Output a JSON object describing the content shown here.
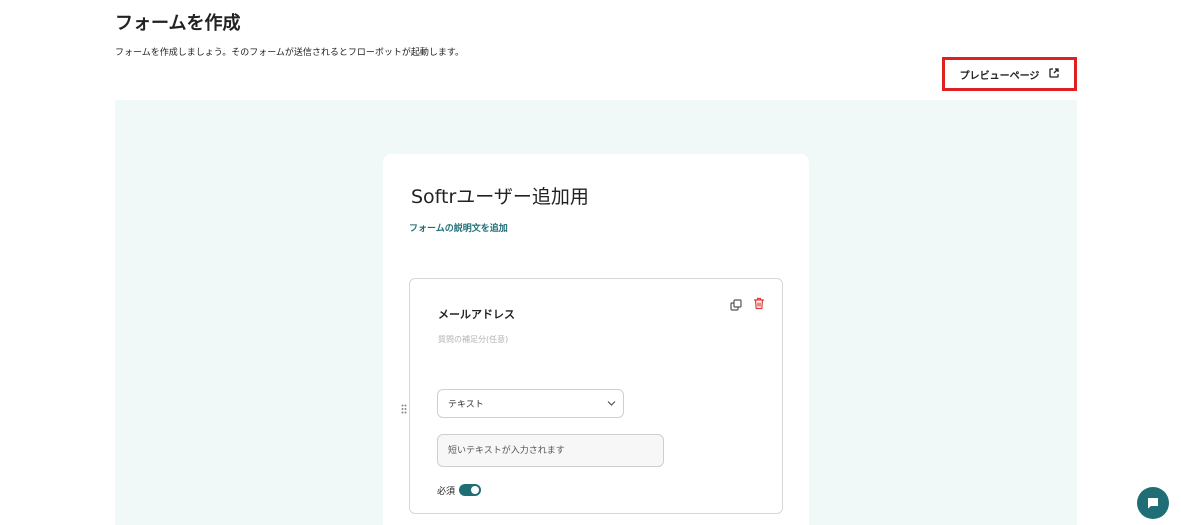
{
  "header": {
    "title": "フォームを作成",
    "description": "フォームを作成しましょう。そのフォームが送信されるとフローボットが起動します。"
  },
  "toolbar": {
    "preview_label": "プレビューページ"
  },
  "form": {
    "title": "Softrユーザー追加用",
    "add_description_label": "フォームの説明文を追加",
    "fields": [
      {
        "label": "メールアドレス",
        "hint": "質問の補足分(任意)",
        "type_value": "テキスト",
        "input_placeholder": "短いテキストが入力されます",
        "required_label": "必須",
        "required": true
      }
    ]
  },
  "colors": {
    "accent": "#1f6e75",
    "highlight_border": "#e02020",
    "canvas_bg": "#f1f9f8",
    "delete": "#e03a3a"
  },
  "icons": {
    "preview": "external-link-icon",
    "copy": "copy-icon",
    "delete": "trash-icon",
    "drag": "drag-handle-icon",
    "dropdown": "chevron-down-icon",
    "chat": "chat-icon"
  }
}
